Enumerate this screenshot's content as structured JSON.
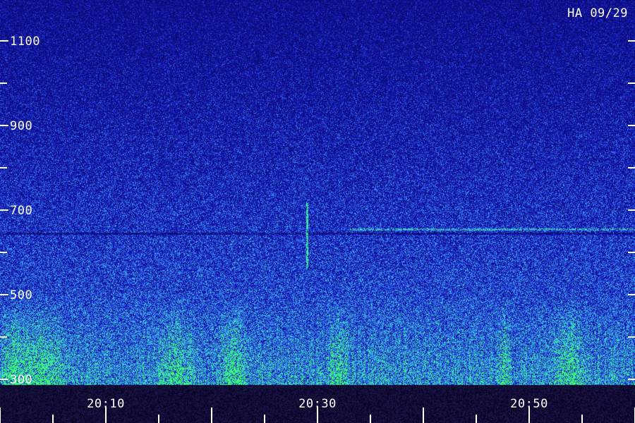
{
  "header": {
    "station_label": "HA 09/29"
  },
  "chart_data": {
    "type": "heatmap",
    "title": "",
    "xlabel": "",
    "ylabel": "",
    "x": {
      "start_time": "20:00",
      "end_time": "21:00",
      "tick_labels": [
        "20:10",
        "20:30",
        "20:50"
      ],
      "minor_tick_minutes": 5
    },
    "y": {
      "range": [
        300,
        1130
      ],
      "tick_labels": [
        1100,
        900,
        700,
        500,
        300
      ],
      "minor_tick_step": 100
    },
    "colors": {
      "background": "#0a0a6e",
      "low": "#1a1ac8",
      "mid": "#3ea0ff",
      "high": "#38e8b8",
      "peak": "#3cff6a",
      "text": "#ffffff"
    },
    "features": [
      {
        "kind": "dark-band",
        "freq": 645
      },
      {
        "kind": "bright-band",
        "freq": 655,
        "from_time": "20:33",
        "to_time": "21:00"
      },
      {
        "kind": "vertical-streak",
        "time": "20:29",
        "freq_from": 560,
        "freq_to": 720
      }
    ]
  }
}
